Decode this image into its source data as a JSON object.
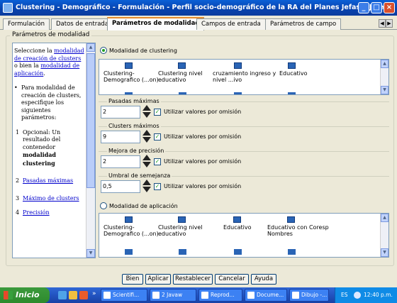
{
  "window": {
    "title": "Clustering - Demográfico - Formulación - Perfil socio-demográfico de la RA del Planes Jefas y Jefes"
  },
  "tabs": [
    "Formulación",
    "Datos de entrada",
    "Parámetros de modalidad",
    "Campos de entrada",
    "Parámetros de campo"
  ],
  "group": {
    "legend": "Parámetros de modalidad"
  },
  "help": {
    "p1_pre": "Seleccione la ",
    "p1_link1": "modalidad de creación de clusters",
    "p1_mid": " o bien la ",
    "p1_link2": "modalidad de aplicación",
    "p1_end": ".",
    "bullet": "•",
    "b1": "Para modalidad de creación de clusters, especifique los siguientes parámetros:",
    "n1": "1",
    "n1_text": "Opcional: Un resultado del contenedor ",
    "n1_bold": "modalidad clustering",
    "n2": "2",
    "n2_link": "Pasadas máximas",
    "n3": "3",
    "n3_link": "Máximo de clusters",
    "n4": "4",
    "n4_link": "Precisión"
  },
  "clustering": {
    "label": "Modalidad de clustering",
    "items": [
      "Clustering-Demografico (...on)",
      "Clustering nivel educativo",
      "cruzamiento ingreso y nivel ...ivo",
      "Educativo"
    ]
  },
  "params": [
    {
      "legend": "Pasadas máximas",
      "value": "2",
      "check_label": "Utilizar valores por omisión",
      "check": "✓"
    },
    {
      "legend": "Clusters máximos",
      "value": "9",
      "check_label": "Utilizar valores por omisión",
      "check": "✓"
    },
    {
      "legend": "Mejora de precisión",
      "value": "2",
      "check_label": "Utilizar valores por omisión",
      "check": "✓"
    },
    {
      "legend": "Umbral de semejanza",
      "value": "0,5",
      "check_label": "Utilizar valores por omisión",
      "check": "✓"
    }
  ],
  "application": {
    "label": "Modalidad de aplicación",
    "items": [
      "Clustering-Demografico (...on)",
      "Clustering nivel educativo",
      "Educativo",
      "Educativo con Coresp Nombres"
    ]
  },
  "buttons": [
    "Bien",
    "Aplicar",
    "Restablecer",
    "Cancelar",
    "Ayuda"
  ],
  "taskbar": {
    "start": "Inicio",
    "chevron": "»",
    "tasks": [
      "Scientifi...",
      "2 Javaw",
      "Reprod...",
      "Docume...",
      "Dibujo -..."
    ],
    "lang": "ES",
    "clock": "12:40 p.m."
  },
  "window_buttons": {
    "min": "_",
    "max": "□",
    "close": "×"
  },
  "arrows": {
    "up": "▲",
    "down": "▼",
    "left": "◀",
    "right": "▶"
  }
}
